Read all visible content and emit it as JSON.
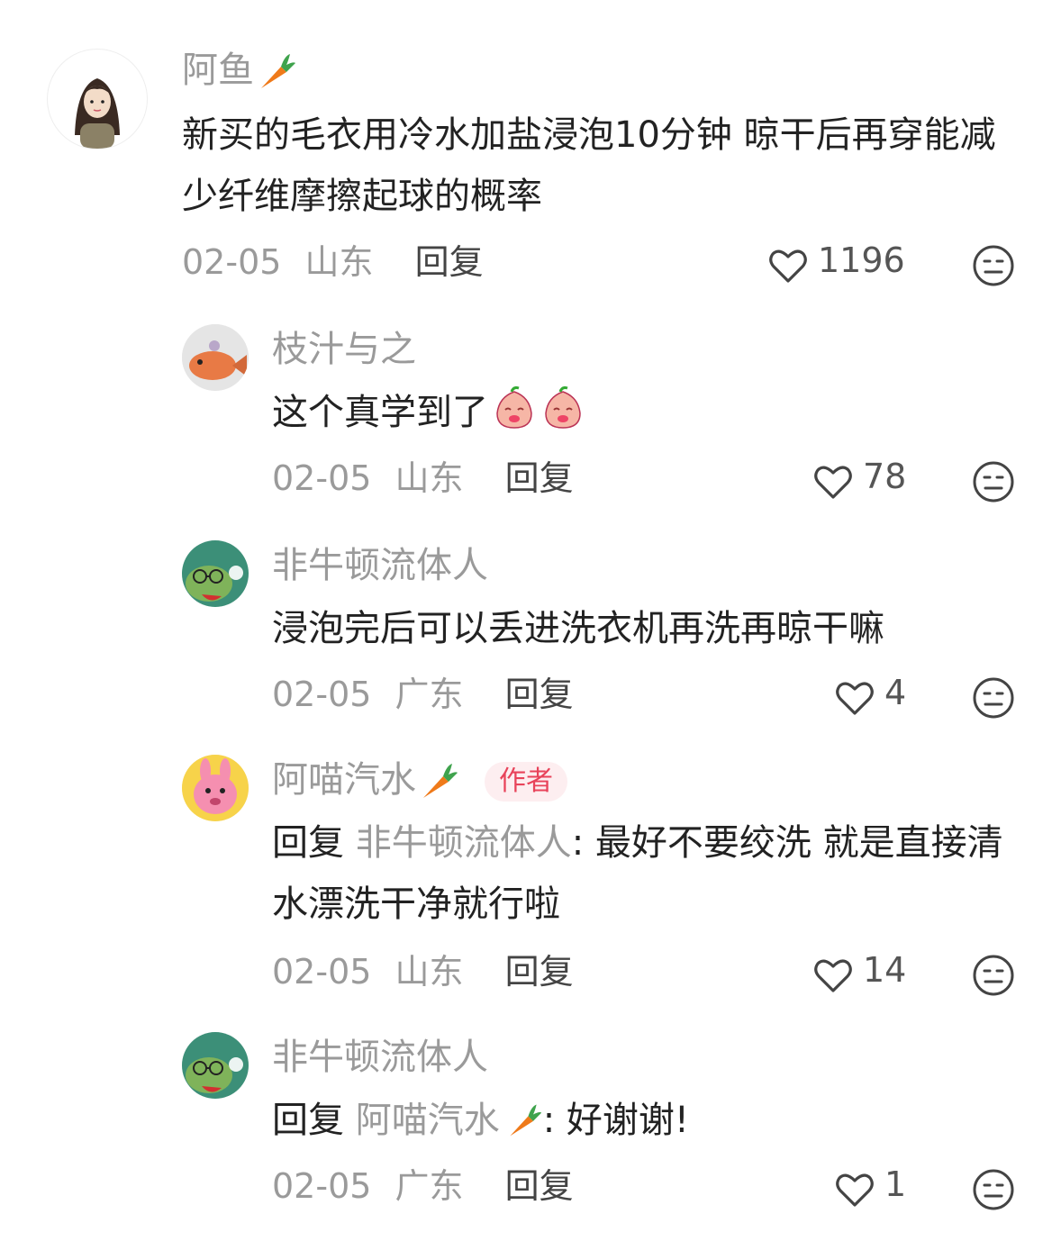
{
  "comments": [
    {
      "author": "阿鱼",
      "has_carrot": true,
      "text": "新买的毛衣用冷水加盐浸泡10分钟 晾干后再穿能减少纤维摩擦起球的概率",
      "date": "02-05",
      "location": "山东",
      "reply_label": "回复",
      "likes": "1196",
      "avatar_icon": "girl-avatar"
    },
    {
      "author": "枝汁与之",
      "text": "这个真学到了",
      "emojis": [
        "blush-peach-emoji",
        "blush-peach-emoji"
      ],
      "date": "02-05",
      "location": "山东",
      "reply_label": "回复",
      "likes": "78",
      "avatar_icon": "fish-avatar"
    },
    {
      "author": "非牛顿流体人",
      "text": "浸泡完后可以丢进洗衣机再洗再晾干嘛",
      "date": "02-05",
      "location": "广东",
      "reply_label": "回复",
      "likes": "4",
      "avatar_icon": "frog-avatar"
    },
    {
      "author": "阿喵汽水",
      "has_carrot": true,
      "badge": "作者",
      "reply_prefix": "回复",
      "reply_target": "非牛顿流体人",
      "text": ": 最好不要绞洗 就是直接清水漂洗干净就行啦",
      "date": "02-05",
      "location": "山东",
      "reply_label": "回复",
      "likes": "14",
      "avatar_icon": "pink-bunny-avatar"
    },
    {
      "author": "非牛顿流体人",
      "reply_prefix": "回复",
      "reply_target": "阿喵汽水",
      "reply_target_carrot": true,
      "text": ": 好谢谢!",
      "date": "02-05",
      "location": "广东",
      "reply_label": "回复",
      "likes": "1",
      "avatar_icon": "frog-avatar"
    }
  ],
  "colors": {
    "text": "#222222",
    "muted": "#9a9a9a",
    "badge_text": "#e8435a",
    "badge_bg": "#fdeef0"
  }
}
